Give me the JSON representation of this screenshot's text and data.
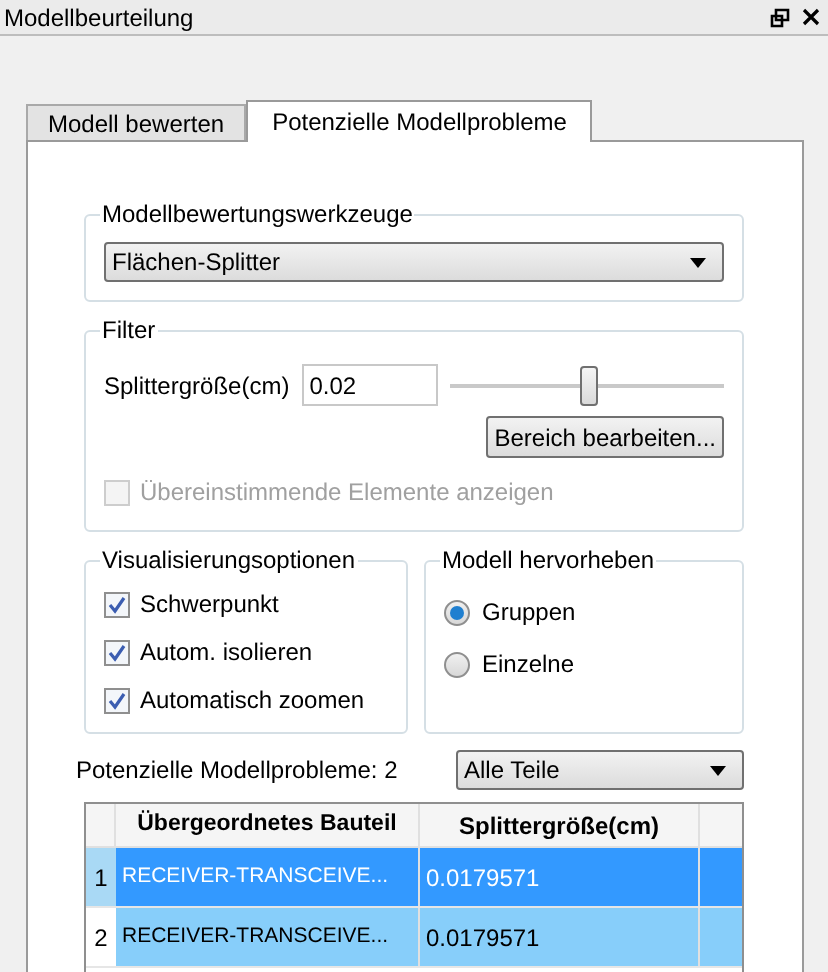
{
  "window": {
    "title": "Modellbeurteilung"
  },
  "tabs": [
    {
      "label": "Modell bewerten",
      "selected": false
    },
    {
      "label": "Potenzielle Modellprobleme",
      "selected": true
    }
  ],
  "tool_group": {
    "title": "Modellbewertungswerkzeuge",
    "dropdown": "Flächen-Splitter"
  },
  "filter": {
    "title": "Filter",
    "field_label": "Splittergröße(cm)",
    "value": "0.02",
    "slider": {
      "level": 0.5
    },
    "button": "Bereich bearbeiten...",
    "match_checkbox": {
      "label": "Übereinstimmende Elemente anzeigen",
      "checked": false,
      "disabled": true
    }
  },
  "visualization": {
    "title": "Visualisierungsoptionen",
    "options": [
      {
        "label": "Schwerpunkt",
        "checked": true
      },
      {
        "label": "Autom. isolieren",
        "checked": true
      },
      {
        "label": "Automatisch zoomen",
        "checked": true
      }
    ]
  },
  "highlight": {
    "title": "Modell hervorheben",
    "options": [
      {
        "label": "Gruppen",
        "selected": true
      },
      {
        "label": "Einzelne",
        "selected": false
      }
    ]
  },
  "problems": {
    "label": "Potenzielle Modellprobleme: 2",
    "filter_dropdown": "Alle Teile"
  },
  "table": {
    "columns": [
      "Übergeordnetes Bauteil",
      "Splittergröße(cm)"
    ],
    "rows": [
      {
        "index": "1",
        "cells": [
          "RECEIVER-TRANSCEIVE...",
          "0.0179571"
        ],
        "selected": true
      },
      {
        "index": "2",
        "cells": [
          "RECEIVER-TRANSCEIVE...",
          "0.0179571"
        ],
        "selected": false
      }
    ]
  }
}
